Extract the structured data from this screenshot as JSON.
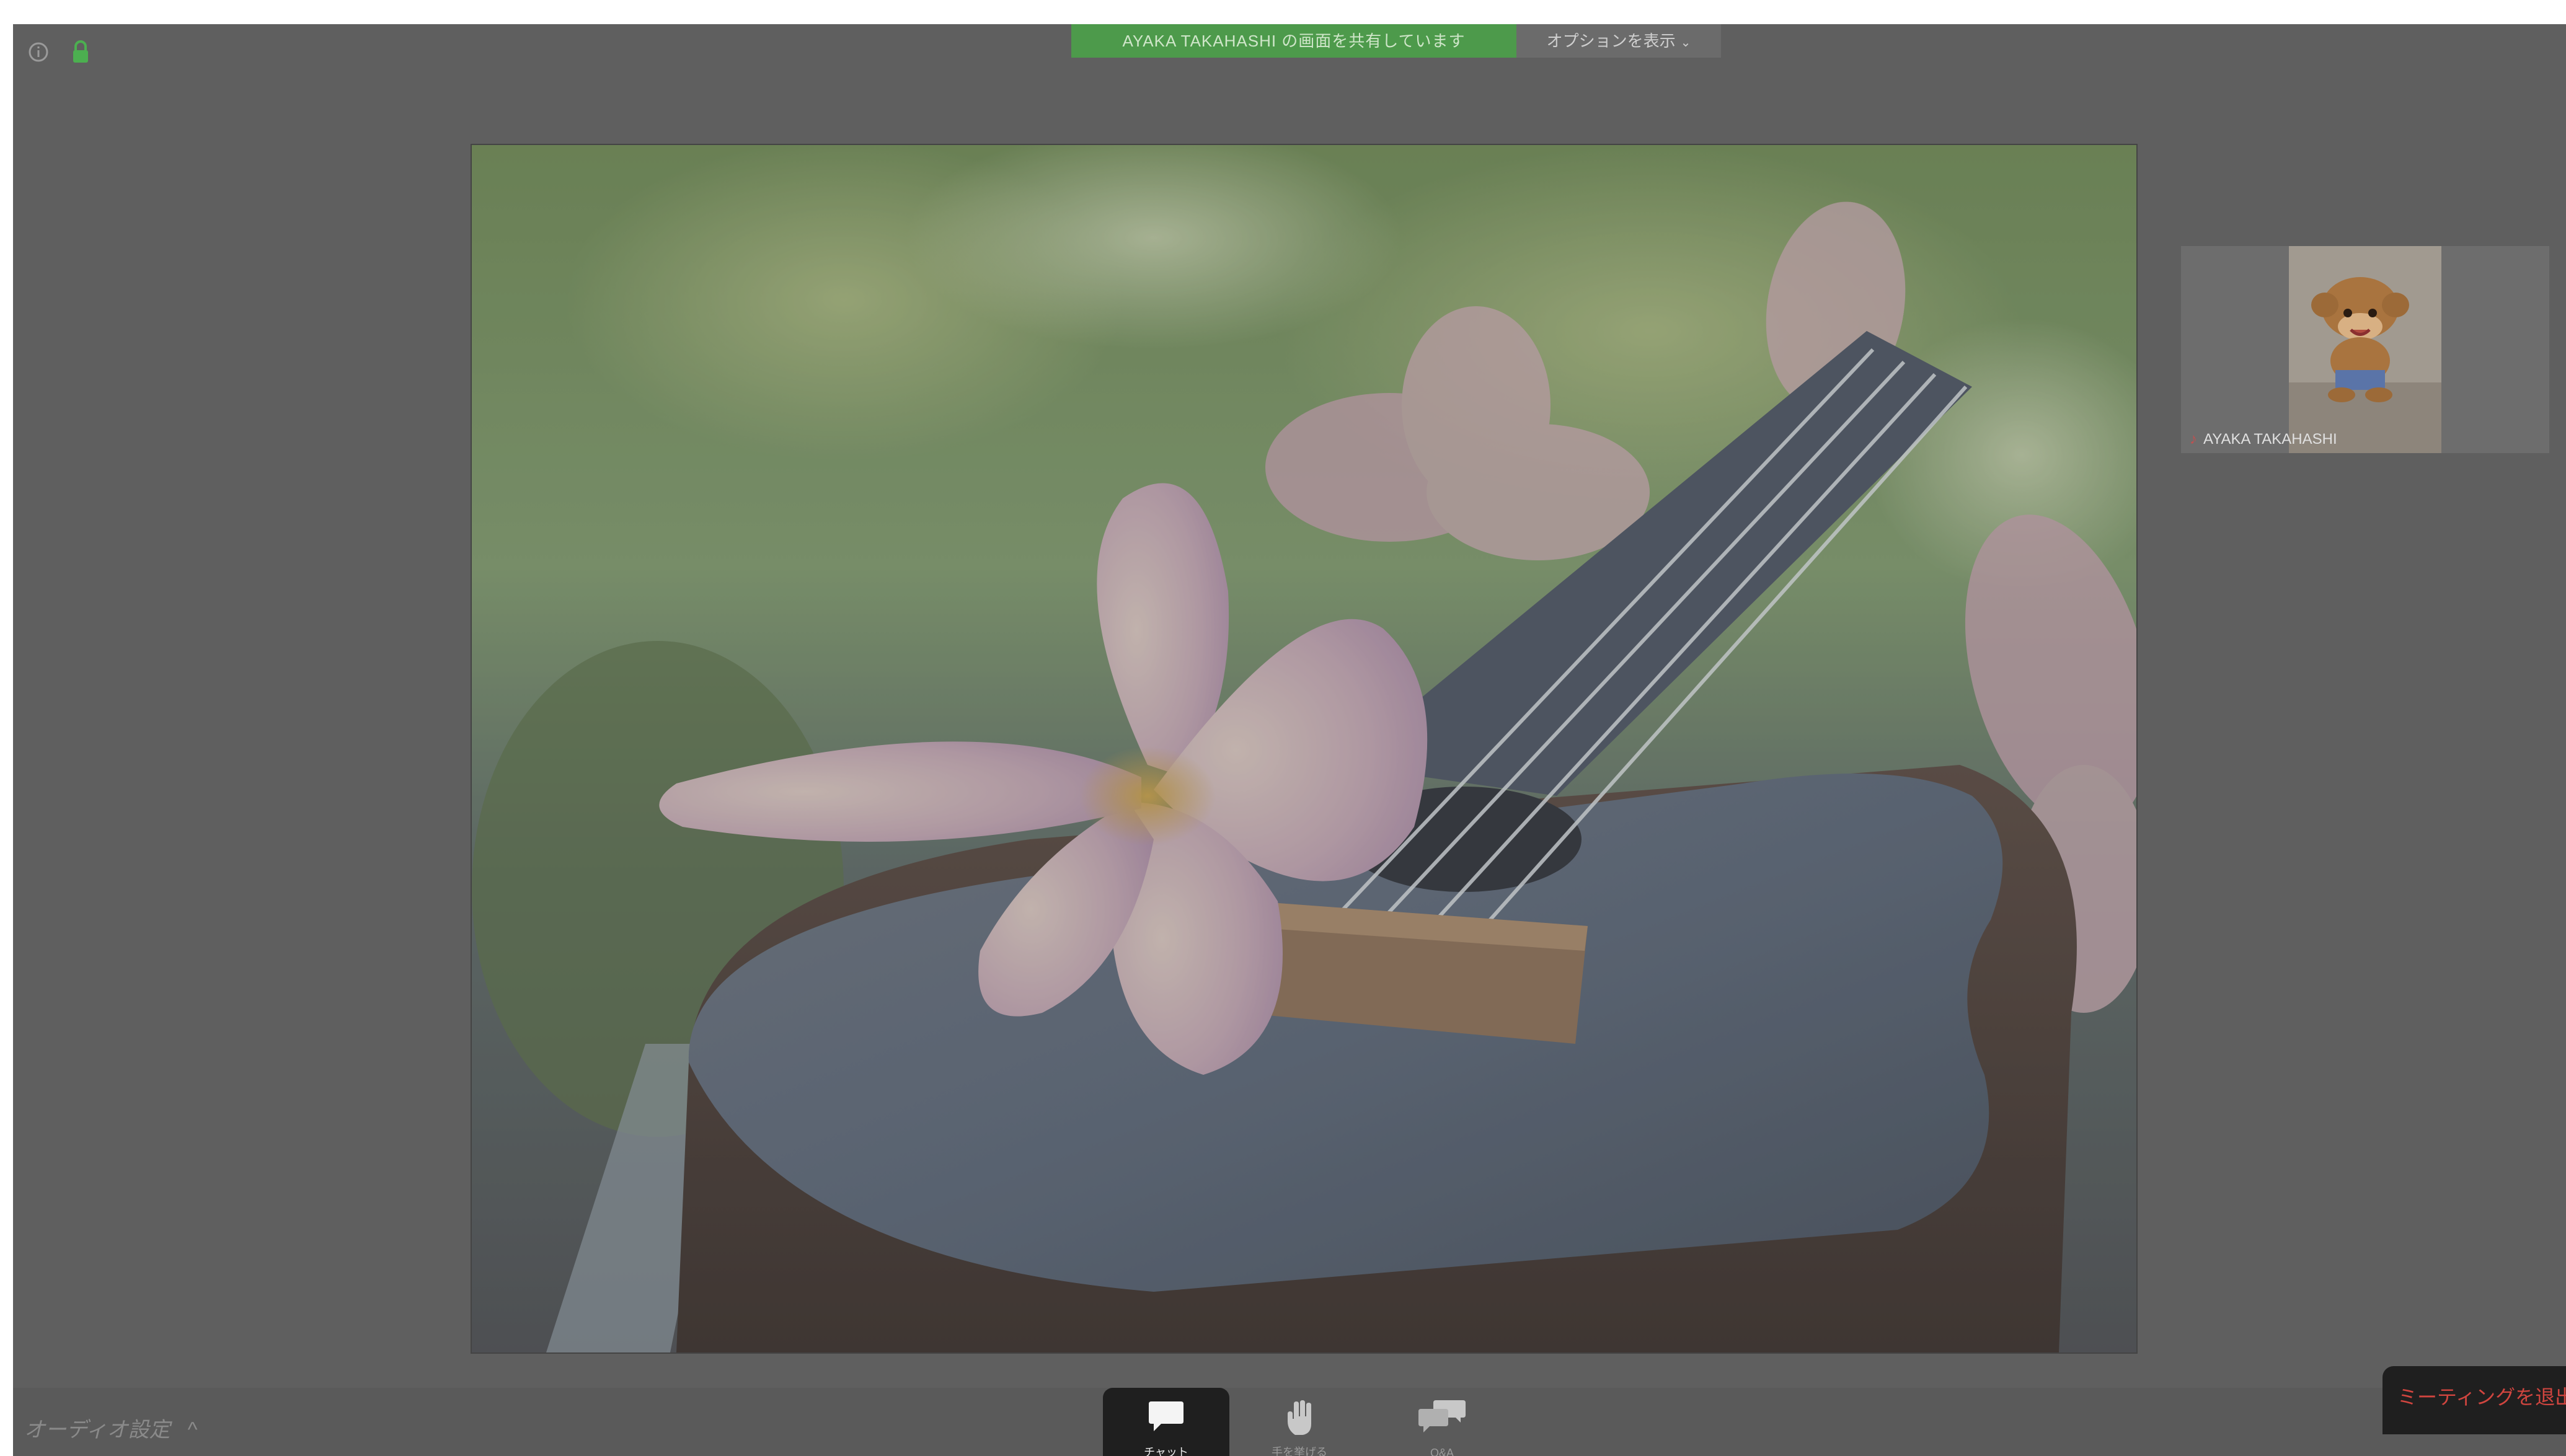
{
  "meeting": {
    "banner_text": "AYAKA TAKAHASHI の画面を共有しています",
    "view_options_label": "オプションを表示",
    "view_options_icon": "chevron-down-icon"
  },
  "status_icons": {
    "info": "info-icon",
    "encryption": "lock-icon",
    "encryption_color": "#4caf50"
  },
  "participant_thumbnail": {
    "name": "AYAKA TAKAHASHI",
    "mic_icon": "mic-muted-icon"
  },
  "toolbar": {
    "audio_settings_label": "オーディオ設定",
    "audio_settings_icon": "chevron-up-icon",
    "chat_label": "チャット",
    "raise_hand_label": "手を挙げる",
    "qa_label": "Q&A",
    "leave_label": "ミーティングを退出",
    "leave_color": "#d0453f"
  }
}
